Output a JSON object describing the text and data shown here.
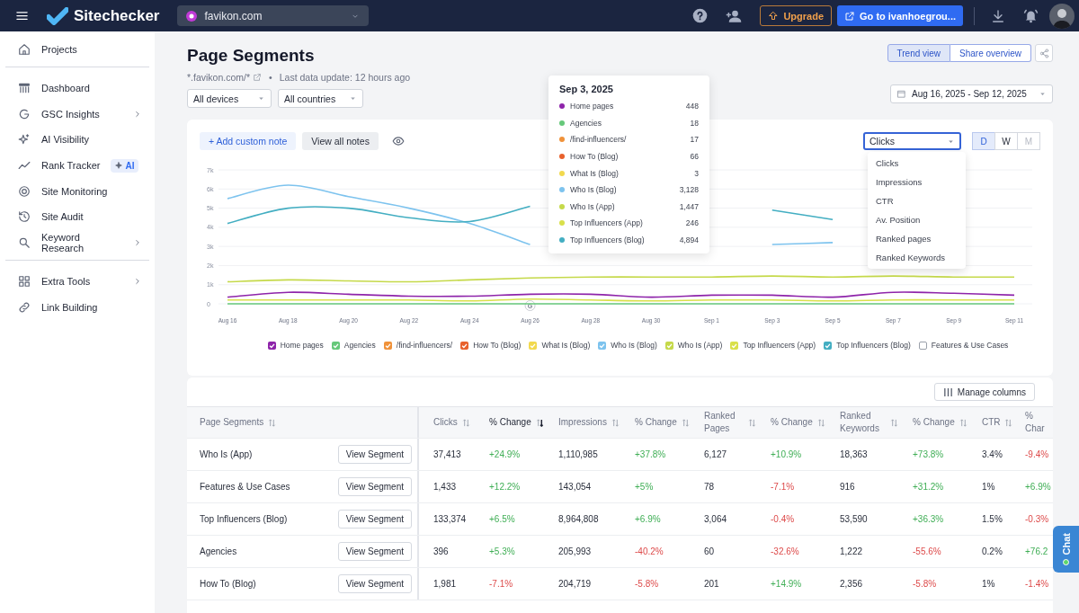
{
  "topbar": {
    "brand": "Sitechecker",
    "site": "favikon.com",
    "upgrade": "Upgrade",
    "goto": "Go to ivanhoegrou..."
  },
  "sidebar": {
    "sections": [
      [
        {
          "label": "Projects",
          "has_submenu": false
        }
      ],
      [
        {
          "label": "Dashboard",
          "has_submenu": false
        },
        {
          "label": "GSC Insights",
          "has_submenu": true
        },
        {
          "label": "AI Visibility",
          "has_submenu": false
        },
        {
          "label": "Rank Tracker",
          "has_submenu": false,
          "badge": "AI"
        },
        {
          "label": "Site Monitoring",
          "has_submenu": false
        },
        {
          "label": "Site Audit",
          "has_submenu": false
        },
        {
          "label": "Keyword Research",
          "has_submenu": true
        }
      ],
      [
        {
          "label": "Extra Tools",
          "has_submenu": true
        },
        {
          "label": "Link Building",
          "has_submenu": false
        }
      ]
    ]
  },
  "header": {
    "title": "Page Segments",
    "domain": "*.favikon.com/*",
    "separator": "•",
    "updated": "Last data update: 12 hours ago",
    "filters": [
      "All devices",
      "All countries"
    ],
    "views": [
      {
        "label": "Trend view",
        "selected": true
      },
      {
        "label": "Share overview",
        "selected": false
      }
    ],
    "date_range": "Aug 16, 2025 - Sep 12, 2025"
  },
  "chart_card": {
    "add_note": "+ Add custom note",
    "view_notes": "View all notes",
    "metric": "Clicks",
    "metric_open": true,
    "metric_options": [
      "Clicks",
      "Impressions",
      "CTR",
      "Av. Position",
      "Ranked pages",
      "Ranked Keywords"
    ],
    "periods": [
      {
        "label": "D",
        "selected": true,
        "disabled": false
      },
      {
        "label": "W",
        "selected": false,
        "disabled": false
      },
      {
        "label": "M",
        "selected": false,
        "disabled": true
      }
    ],
    "chart_data": {
      "type": "line",
      "grid": true,
      "categories": [
        "Aug 16",
        "Aug 18",
        "Aug 20",
        "Aug 22",
        "Aug 24",
        "Aug 26",
        "Aug 28",
        "Aug 30",
        "Sep 1",
        "Sep 3",
        "Sep 5",
        "Sep 7",
        "Sep 9",
        "Sep 11"
      ],
      "yticks": [
        {
          "value": 0,
          "label": "0"
        },
        {
          "value": 1000,
          "label": "1k"
        },
        {
          "value": 2000,
          "label": "2k"
        },
        {
          "value": 3000,
          "label": "3k"
        },
        {
          "value": 4000,
          "label": "4k"
        },
        {
          "value": 5000,
          "label": "5k"
        },
        {
          "value": 6000,
          "label": "6k"
        },
        {
          "value": 7000,
          "label": "7k"
        }
      ],
      "ylim": [
        0,
        7000
      ],
      "annotations": [
        {
          "x": "Aug 26",
          "text": "G"
        }
      ],
      "series": [
        {
          "name": "Home pages",
          "color": "#8e24aa",
          "values": [
            350,
            600,
            500,
            400,
            400,
            500,
            500,
            350,
            450,
            450,
            350,
            600,
            550,
            450
          ]
        },
        {
          "name": "Agencies",
          "color": "#66c87a",
          "values": [
            0,
            0,
            0,
            0,
            0,
            0,
            0,
            0,
            0,
            0,
            0,
            0,
            0,
            0
          ]
        },
        {
          "name": "/find-influencers/",
          "color": "#f0923a",
          "values": [
            null,
            null,
            null,
            null,
            null,
            null,
            null,
            null,
            null,
            null,
            null,
            null,
            null,
            null
          ]
        },
        {
          "name": "How To (Blog)",
          "color": "#e8612c",
          "values": [
            null,
            null,
            null,
            null,
            null,
            null,
            null,
            null,
            null,
            null,
            null,
            null,
            null,
            null
          ]
        },
        {
          "name": "What Is (Blog)",
          "color": "#f2d94e",
          "values": [
            null,
            null,
            null,
            null,
            null,
            null,
            null,
            null,
            null,
            null,
            null,
            null,
            null,
            null
          ]
        },
        {
          "name": "Who Is (Blog)",
          "color": "#7dc3ee",
          "values": [
            5500,
            6200,
            5600,
            5000,
            4200,
            3100,
            null,
            null,
            null,
            3100,
            3200,
            null,
            null,
            null
          ]
        },
        {
          "name": "Who Is (App)",
          "color": "#c5d94a",
          "values": [
            1150,
            1250,
            1200,
            1150,
            1250,
            1350,
            1400,
            1400,
            1400,
            1450,
            1400,
            1450,
            1400,
            1400
          ]
        },
        {
          "name": "Top Influencers (App)",
          "color": "#d9e04a",
          "values": [
            200,
            200,
            200,
            200,
            150,
            250,
            200,
            150,
            200,
            200,
            150,
            200,
            200,
            200
          ]
        },
        {
          "name": "Top Influencers (Blog)",
          "color": "#43aec2",
          "values": [
            4200,
            5000,
            5000,
            4500,
            4300,
            5100,
            null,
            null,
            null,
            4900,
            4400,
            null,
            null,
            null
          ]
        },
        {
          "name": "Features & Use Cases",
          "color": "#9aa0aa",
          "values": [
            null,
            null,
            null,
            null,
            null,
            null,
            null,
            null,
            null,
            null,
            null,
            null,
            null,
            null
          ]
        }
      ]
    },
    "legend": [
      {
        "checked": true
      },
      {
        "checked": true
      },
      {
        "checked": true
      },
      {
        "checked": true
      },
      {
        "checked": true
      },
      {
        "checked": true
      },
      {
        "checked": true
      },
      {
        "checked": true
      },
      {
        "checked": true
      },
      {
        "checked": false
      }
    ],
    "tooltip": {
      "date": "Sep 3, 2025",
      "items": [
        {
          "name": "Home pages",
          "color": "#8e24aa",
          "value": "448"
        },
        {
          "name": "Agencies",
          "color": "#66c87a",
          "value": "18"
        },
        {
          "name": "/find-influencers/",
          "color": "#f0923a",
          "value": "17"
        },
        {
          "name": "How To (Blog)",
          "color": "#e8612c",
          "value": "66"
        },
        {
          "name": "What Is (Blog)",
          "color": "#f2d94e",
          "value": "3"
        },
        {
          "name": "Who Is (Blog)",
          "color": "#7dc3ee",
          "value": "3,128"
        },
        {
          "name": "Who Is (App)",
          "color": "#c5d94a",
          "value": "1,447"
        },
        {
          "name": "Top Influencers (App)",
          "color": "#d9e04a",
          "value": "246"
        },
        {
          "name": "Top Influencers (Blog)",
          "color": "#43aec2",
          "value": "4,894"
        }
      ]
    }
  },
  "table": {
    "manage_columns": "Manage columns",
    "columns": [
      {
        "label": "Page Segments",
        "sorted": false
      },
      {
        "label": "Clicks",
        "sorted": false
      },
      {
        "label": "% Change",
        "sorted": true
      },
      {
        "label": "Impressions",
        "sorted": false
      },
      {
        "label": "% Change",
        "sorted": false
      },
      {
        "label": "Ranked Pages",
        "sorted": false
      },
      {
        "label": "% Change",
        "sorted": false
      },
      {
        "label": "Ranked Keywords",
        "sorted": false
      },
      {
        "label": "% Change",
        "sorted": false
      },
      {
        "label": "CTR",
        "sorted": false
      },
      {
        "label": "% Char"
      }
    ],
    "rows": [
      {
        "cells": [
          {
            "text": "Who Is (App)",
            "action": "View Segment"
          },
          {
            "text": "37,413"
          },
          {
            "text": "+24.9%",
            "positive": true
          },
          {
            "text": "1,110,985"
          },
          {
            "text": "+37.8%",
            "positive": true
          },
          {
            "text": "6,127"
          },
          {
            "text": "+10.9%",
            "positive": true
          },
          {
            "text": "18,363"
          },
          {
            "text": "+73.8%",
            "positive": true
          },
          {
            "text": "3.4%"
          },
          {
            "text": "-9.4%",
            "positive": false
          }
        ]
      },
      {
        "cells": [
          {
            "text": "Features & Use Cases",
            "action": "View Segment"
          },
          {
            "text": "1,433"
          },
          {
            "text": "+12.2%",
            "positive": true
          },
          {
            "text": "143,054"
          },
          {
            "text": "+5%",
            "positive": true
          },
          {
            "text": "78"
          },
          {
            "text": "-7.1%",
            "positive": false
          },
          {
            "text": "916"
          },
          {
            "text": "+31.2%",
            "positive": true
          },
          {
            "text": "1%"
          },
          {
            "text": "+6.9%",
            "positive": true
          }
        ]
      },
      {
        "cells": [
          {
            "text": "Top Influencers (Blog)",
            "action": "View Segment"
          },
          {
            "text": "133,374"
          },
          {
            "text": "+6.5%",
            "positive": true
          },
          {
            "text": "8,964,808"
          },
          {
            "text": "+6.9%",
            "positive": true
          },
          {
            "text": "3,064"
          },
          {
            "text": "-0.4%",
            "positive": false
          },
          {
            "text": "53,590"
          },
          {
            "text": "+36.3%",
            "positive": true
          },
          {
            "text": "1.5%"
          },
          {
            "text": "-0.3%",
            "positive": false
          }
        ]
      },
      {
        "cells": [
          {
            "text": "Agencies",
            "action": "View Segment"
          },
          {
            "text": "396"
          },
          {
            "text": "+5.3%",
            "positive": true
          },
          {
            "text": "205,993"
          },
          {
            "text": "-40.2%",
            "positive": false
          },
          {
            "text": "60"
          },
          {
            "text": "-32.6%",
            "positive": false
          },
          {
            "text": "1,222"
          },
          {
            "text": "-55.6%",
            "positive": false
          },
          {
            "text": "0.2%"
          },
          {
            "text": "+76.2",
            "positive": true
          }
        ]
      },
      {
        "cells": [
          {
            "text": "How To (Blog)",
            "action": "View Segment"
          },
          {
            "text": "1,981"
          },
          {
            "text": "-7.1%",
            "positive": false
          },
          {
            "text": "204,719"
          },
          {
            "text": "-5.8%",
            "positive": false
          },
          {
            "text": "201"
          },
          {
            "text": "+14.9%",
            "positive": true
          },
          {
            "text": "2,356"
          },
          {
            "text": "-5.8%",
            "positive": false
          },
          {
            "text": "1%"
          },
          {
            "text": "-1.4%",
            "positive": false
          }
        ]
      }
    ]
  },
  "chat": {
    "label": "Chat",
    "online": true
  }
}
